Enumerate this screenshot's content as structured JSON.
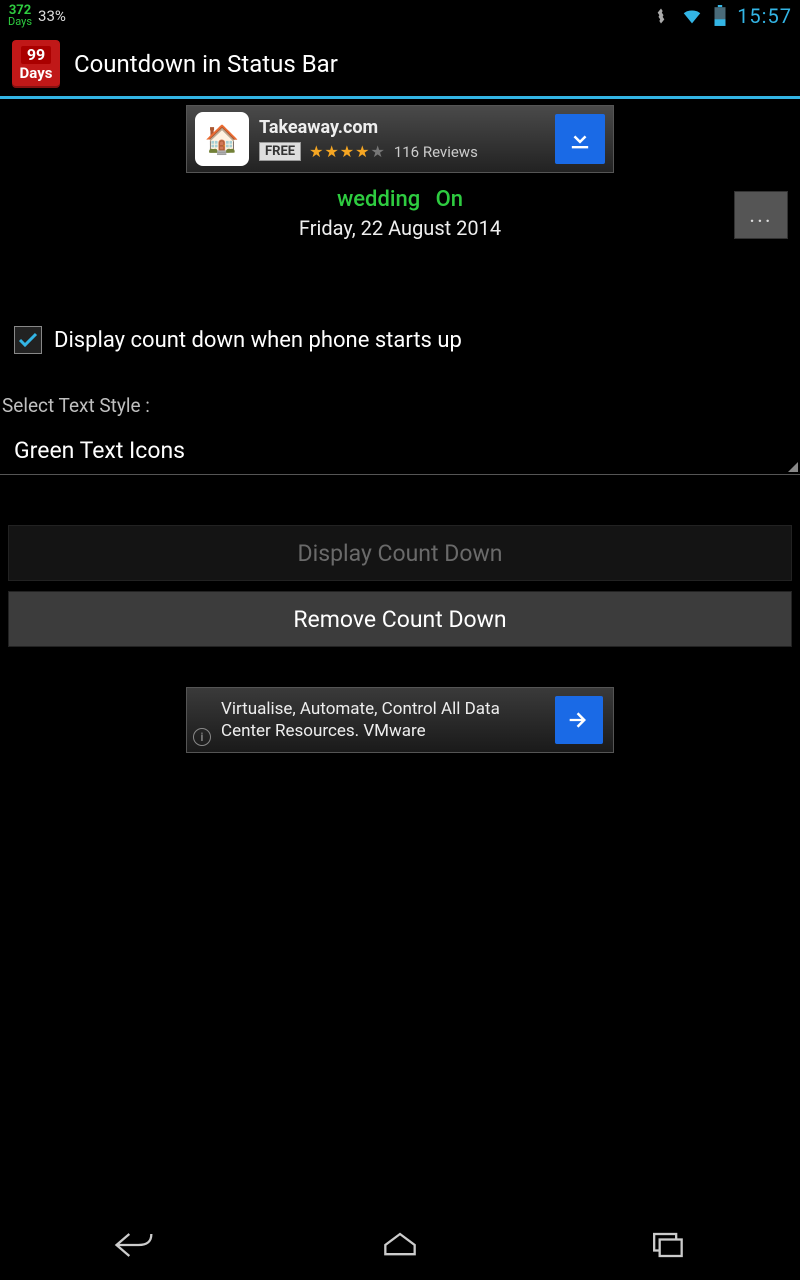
{
  "statusbar": {
    "days_count": "372",
    "days_label": "Days",
    "battery_pct": "33%",
    "clock": "15:57"
  },
  "actionbar": {
    "app_icon_top": "99",
    "app_icon_bottom": "Days",
    "title": "Countdown in Status Bar"
  },
  "ad1": {
    "title": "Takeaway.com",
    "badge": "FREE",
    "reviews": "116 Reviews"
  },
  "event": {
    "name": "wedding",
    "on": "On",
    "date": "Friday, 22 August 2014",
    "more": "..."
  },
  "checkbox": {
    "label": "Display count down when phone starts up"
  },
  "style_select": {
    "label": "Select Text Style :",
    "value": "Green Text Icons"
  },
  "buttons": {
    "display": "Display Count Down",
    "remove": "Remove Count Down"
  },
  "ad2": {
    "text": "Virtualise, Automate, Control All Data Center Resources. VMware"
  }
}
